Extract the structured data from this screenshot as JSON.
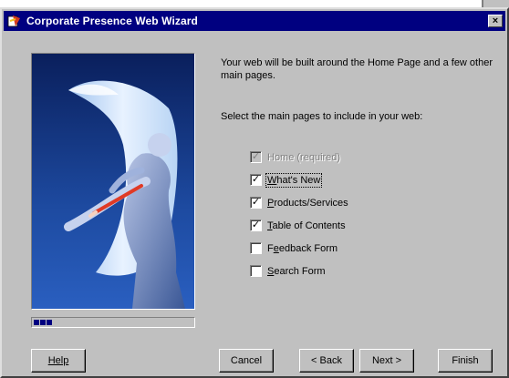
{
  "window": {
    "title": "Corporate Presence Web Wizard",
    "close_glyph": "×"
  },
  "wizard": {
    "intro": "Your web will be built around the Home Page and a few other main pages.",
    "select_label": "Select the main pages to include in your web:",
    "pages": [
      {
        "label": "Home (required)",
        "checked": true,
        "enabled": false,
        "mnemonic_index": -1
      },
      {
        "label": "What's New",
        "checked": true,
        "enabled": true,
        "mnemonic_index": 0
      },
      {
        "label": "Products/Services",
        "checked": true,
        "enabled": true,
        "mnemonic_index": 0
      },
      {
        "label": "Table of Contents",
        "checked": true,
        "enabled": true,
        "mnemonic_index": 0
      },
      {
        "label": "Feedback Form",
        "checked": false,
        "enabled": true,
        "mnemonic_index": 1
      },
      {
        "label": "Search Form",
        "checked": false,
        "enabled": true,
        "mnemonic_index": 0
      }
    ],
    "check_glyph": "✓",
    "progress_fraction": 0.12
  },
  "buttons": {
    "help": "Help",
    "cancel": "Cancel",
    "back": "< Back",
    "next": "Next >",
    "finish": "Finish"
  },
  "colors": {
    "titlebar": "#000080",
    "dialog_face": "#c0c0c0"
  }
}
